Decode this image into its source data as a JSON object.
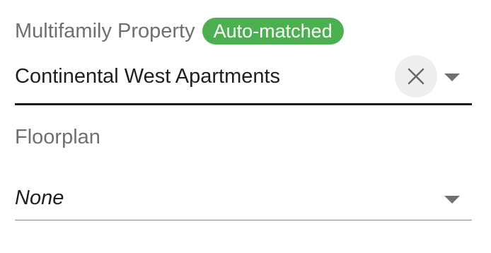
{
  "property_field": {
    "label": "Multifamily Property",
    "badge": "Auto-matched",
    "value": "Continental West Apartments",
    "clear_icon": "close-icon",
    "dropdown_icon": "caret-down-icon"
  },
  "floorplan_field": {
    "label": "Floorplan",
    "value": "None",
    "dropdown_icon": "caret-down-icon"
  },
  "colors": {
    "badge_bg": "#4caf50",
    "label_text": "#6f6f6f",
    "value_text": "#1f1f1f"
  }
}
